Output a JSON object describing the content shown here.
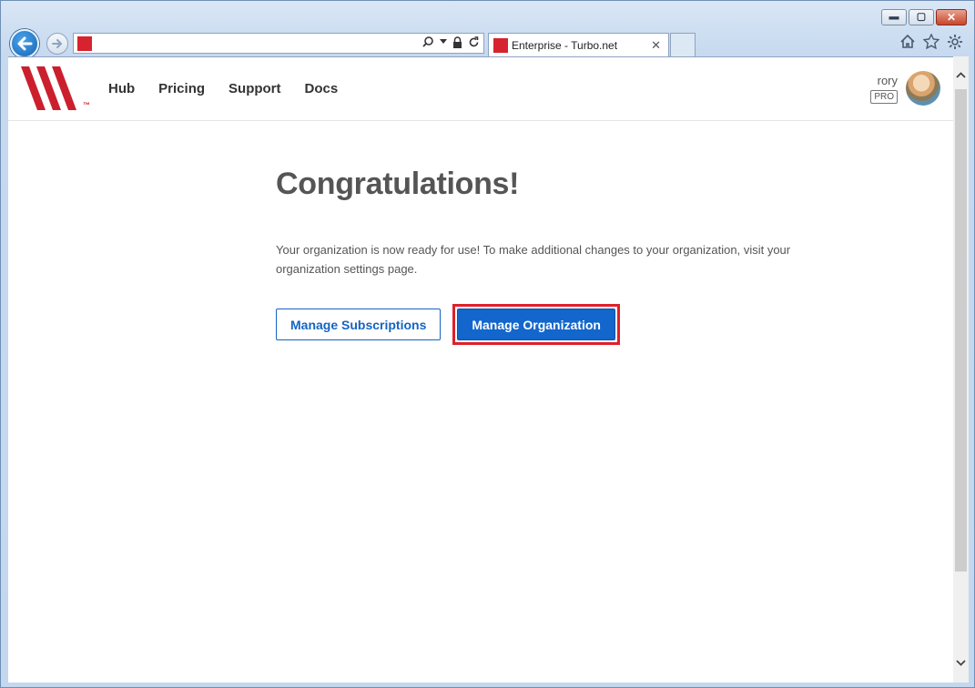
{
  "browser": {
    "window_controls": {
      "minimize": "▬",
      "maximize": "▢",
      "close": "✕"
    },
    "address_bar": {
      "value": ""
    },
    "tab": {
      "title": "Enterprise - Turbo.net",
      "close": "✕"
    },
    "icons": [
      "back-icon",
      "forward-icon",
      "search-icon",
      "lock-icon",
      "refresh-icon",
      "home-icon",
      "favorites-icon",
      "settings-icon"
    ],
    "colors": {
      "favicon": "#d6232e",
      "back_button": "#1b74c9"
    }
  },
  "header": {
    "logo_tm": "™",
    "nav": [
      {
        "label": "Hub"
      },
      {
        "label": "Pricing"
      },
      {
        "label": "Support"
      },
      {
        "label": "Docs"
      }
    ],
    "user": {
      "name": "rory",
      "badge": "PRO"
    }
  },
  "main": {
    "title": "Congratulations!",
    "message": "Your organization is now ready for use! To make additional changes to your organization, visit your organization settings page.",
    "buttons": {
      "secondary": "Manage Subscriptions",
      "primary": "Manage Organization"
    },
    "colors": {
      "primary": "#1266cc",
      "highlight_border": "#e0202b",
      "logo": "#cc1f2d"
    }
  }
}
